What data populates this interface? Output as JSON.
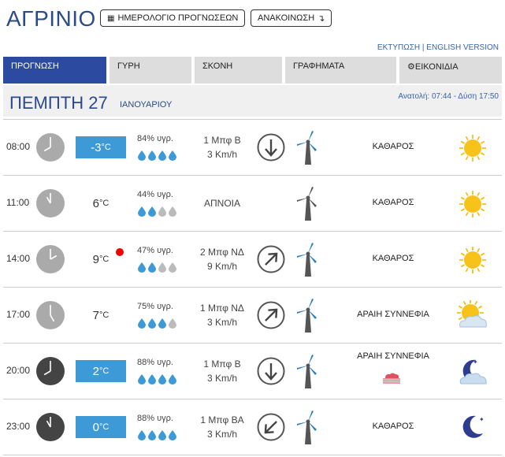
{
  "header": {
    "city": "ΑΓΡΙΝΙΟ",
    "calendar_button": "ΗΜΕΡΟΛΟΓΙΟ ΠΡΟΓΝΩΣΕΩΝ",
    "announce_button": "ΑΝΑΚΟΙΝΩΣΗ",
    "print_link": "ΕΚΤΥΠΩΣΗ",
    "separator": "|",
    "english_link": "ENGLISH VERSION"
  },
  "tabs": [
    {
      "label": "ΠΡΟΓΝΩΣΗ",
      "active": true
    },
    {
      "label": "ΓΥΡΗ",
      "active": false
    },
    {
      "label": "ΣΚΟΝΗ",
      "active": false
    },
    {
      "label": "ΓΡΑΦΗΜΑΤΑ",
      "active": false
    },
    {
      "label": "ΕΙΚΟΝΙΔΙΑ",
      "active": false
    }
  ],
  "day": {
    "name": "ΠΕΜΠΤΗ 27",
    "month": "ΙΑΝΟΥΑΡΙΟΥ",
    "sun": "Ανατολή: 07:44 - Δύση 17:50"
  },
  "forecast": [
    {
      "time": "08:00",
      "temp": "-3",
      "unit": "°C",
      "highlight": true,
      "humidity": "84% υγρ.",
      "drops": 4,
      "wind_force": "1 Μπφ Β",
      "wind_speed": "3 Km/h",
      "wind_dir": 180,
      "calm": false,
      "condition": "ΚΑΘΑΡΟΣ",
      "icon": "sun-icon",
      "rain": false,
      "night_clock": false,
      "hour": 8
    },
    {
      "time": "11:00",
      "temp": "6",
      "unit": "°C",
      "highlight": false,
      "humidity": "44% υγρ.",
      "drops": 2,
      "wind_force": "ΑΠΝΟΙΑ",
      "wind_speed": "",
      "wind_dir": null,
      "calm": true,
      "condition": "ΚΑΘΑΡΟΣ",
      "icon": "sun-icon",
      "rain": false,
      "night_clock": false,
      "hour": 11
    },
    {
      "time": "14:00",
      "temp": "9",
      "unit": "°C",
      "highlight": false,
      "humidity": "47% υγρ.",
      "drops": 2,
      "wind_force": "2 Μπφ ΝΔ",
      "wind_speed": "9 Km/h",
      "wind_dir": 45,
      "calm": false,
      "condition": "ΚΑΘΑΡΟΣ",
      "icon": "sun-icon",
      "rain": true,
      "night_clock": false,
      "hour": 14
    },
    {
      "time": "17:00",
      "temp": "7",
      "unit": "°C",
      "highlight": false,
      "humidity": "75% υγρ.",
      "drops": 3,
      "wind_force": "1 Μπφ ΝΔ",
      "wind_speed": "3 Km/h",
      "wind_dir": 45,
      "calm": false,
      "condition": "ΑΡΑΙΗ ΣΥΝΝΕΦΙΑ",
      "icon": "sun-cloud-icon",
      "rain": false,
      "night_clock": false,
      "hour": 17
    },
    {
      "time": "20:00",
      "temp": "2",
      "unit": "°C",
      "highlight": true,
      "humidity": "88% υγρ.",
      "drops": 4,
      "wind_force": "1 Μπφ Β",
      "wind_speed": "3 Km/h",
      "wind_dir": 180,
      "calm": false,
      "condition": "ΑΡΑΙΗ ΣΥΝΝΕΦΙΑ",
      "icon": "moon-cloud-icon",
      "rain": false,
      "night_clock": true,
      "hour": 20,
      "haze": true
    },
    {
      "time": "23:00",
      "temp": "0",
      "unit": "°C",
      "highlight": true,
      "humidity": "88% υγρ.",
      "drops": 4,
      "wind_force": "1 Μπφ ΒΑ",
      "wind_speed": "3 Km/h",
      "wind_dir": 225,
      "calm": false,
      "condition": "ΚΑΘΑΡΟΣ",
      "icon": "moon-icon",
      "rain": false,
      "night_clock": true,
      "hour": 23
    }
  ]
}
